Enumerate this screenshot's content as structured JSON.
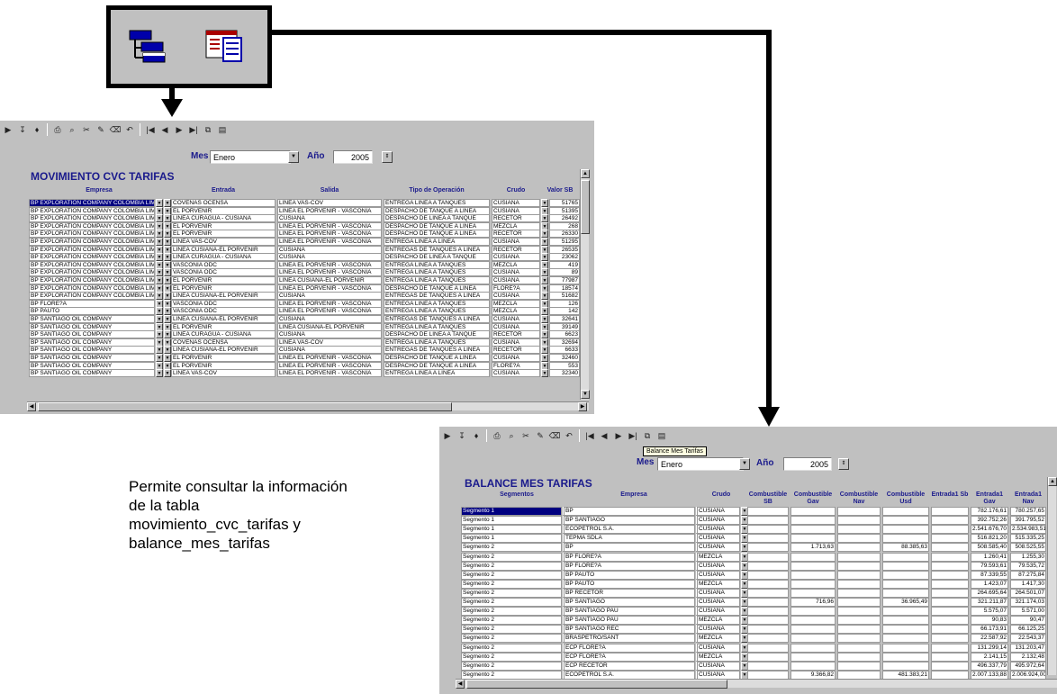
{
  "caption": "Permite consultar la información de la tabla movimiento_cvc_tarifas y balance_mes_tarifas",
  "big_toolbar": {
    "icons": [
      "forms-tree-icon",
      "report-sheet-icon"
    ]
  },
  "toolbar_glyphs": [
    "▶",
    "↧",
    "♦",
    "⎙",
    "⌕",
    "✂",
    "✎",
    "⌫",
    "↶",
    "|◀",
    "◀",
    "▶",
    "▶|",
    "⧉",
    "▤"
  ],
  "mov": {
    "mes_label": "Mes",
    "mes_value": "Enero",
    "anio_label": "Año",
    "anio_value": "2005",
    "title": "MOVIMIENTO CVC TARIFAS",
    "columns": [
      "Empresa",
      "Entrada",
      "Salida",
      "Tipo de Operación",
      "Crudo",
      "Valor SB"
    ],
    "rows": [
      [
        "BP EXPLORATION COMPANY COLOMBIA LIMI",
        "COVENAS OCENSA",
        "LINEA VAS-COV",
        "ENTREGA LINEA A TANQUES",
        "CUSIANA",
        "51765"
      ],
      [
        "BP EXPLORATION COMPANY COLOMBIA LIMI",
        "EL PORVENIR",
        "LINEA  EL PORVENIR - VASCONIA",
        "DESPACHO DE TANQUE A LINEA",
        "CUSIANA",
        "51395"
      ],
      [
        "BP EXPLORATION COMPANY COLOMBIA LIMI",
        "LINEA CURAGUA - CUSIANA",
        "CUSIANA",
        "DESPACHO DE LINEA A TANQUE",
        "RECETOR",
        "26492"
      ],
      [
        "BP EXPLORATION COMPANY COLOMBIA LIMI",
        "EL PORVENIR",
        "LINEA  EL PORVENIR - VASCONIA",
        "DESPACHO DE TANQUE A LINEA",
        "MEZCLA",
        "268"
      ],
      [
        "BP EXPLORATION COMPANY COLOMBIA LIMI",
        "EL PORVENIR",
        "LINEA  EL PORVENIR - VASCONIA",
        "DESPACHO DE TANQUE A LINEA",
        "RECETOR",
        "26330"
      ],
      [
        "BP EXPLORATION COMPANY COLOMBIA LIMI",
        "LINEA VAS-COV",
        "LINEA  EL PORVENIR - VASCONIA",
        "ENTREGA LINEA A LINEA",
        "CUSIANA",
        "51295"
      ],
      [
        "BP EXPLORATION COMPANY COLOMBIA LIMI",
        "LINEA  CUSIANA-EL PORVENIR",
        "CUSIANA",
        "ENTREGAS DE TANQUES A LINEA",
        "RECETOR",
        "26535"
      ],
      [
        "BP EXPLORATION COMPANY COLOMBIA LIMI",
        "LINEA CURAGUA - CUSIANA",
        "CUSIANA",
        "DESPACHO DE LINEA A TANQUE",
        "CUSIANA",
        "23062"
      ],
      [
        "BP EXPLORATION COMPANY COLOMBIA LIMI",
        "VASCONIA ODC",
        "LINEA  EL PORVENIR - VASCONIA",
        "ENTREGA LINEA A TANQUES",
        "MEZCLA",
        "419"
      ],
      [
        "BP EXPLORATION COMPANY COLOMBIA LIMI",
        "VASCONIA ODC",
        "LINEA  EL PORVENIR - VASCONIA",
        "ENTREGA LINEA A TANQUES",
        "CUSIANA",
        "89"
      ],
      [
        "BP EXPLORATION COMPANY COLOMBIA LIMI",
        "EL PORVENIR",
        "LINEA  CUSIANA-EL PORVENIR",
        "ENTREGA LINEA A TANQUES",
        "CUSIANA",
        "77987"
      ],
      [
        "BP EXPLORATION COMPANY COLOMBIA LIMI",
        "EL PORVENIR",
        "LINEA  EL PORVENIR - VASCONIA",
        "DESPACHO DE TANQUE A LINEA",
        "FLORE?A",
        "18574"
      ],
      [
        "BP EXPLORATION COMPANY COLOMBIA LIMI",
        "LINEA  CUSIANA-EL PORVENIR",
        "CUSIANA",
        "ENTREGAS DE TANQUES A LINEA",
        "CUSIANA",
        "51682"
      ],
      [
        "BP FLORE?A",
        "VASCONIA ODC",
        "LINEA  EL PORVENIR - VASCONIA",
        "ENTREGA LINEA A TANQUES",
        "MEZCLA",
        "126"
      ],
      [
        "BP PAUTO",
        "VASCONIA ODC",
        "LINEA  EL PORVENIR - VASCONIA",
        "ENTREGA LINEA A TANQUES",
        "MEZCLA",
        "142"
      ],
      [
        "BP SANTIAGO OIL COMPANY",
        "LINEA  CUSIANA-EL PORVENIR",
        "CUSIANA",
        "ENTREGAS DE TANQUES A LINEA",
        "CUSIANA",
        "32641"
      ],
      [
        "BP SANTIAGO OIL COMPANY",
        "EL PORVENIR",
        "LINEA  CUSIANA-EL PORVENIR",
        "ENTREGA LINEA A TANQUES",
        "CUSIANA",
        "39149"
      ],
      [
        "BP SANTIAGO OIL COMPANY",
        "LINEA CURAGUA - CUSIANA",
        "CUSIANA",
        "DESPACHO DE LINEA A TANQUE",
        "RECETOR",
        "6623"
      ],
      [
        "BP SANTIAGO OIL COMPANY",
        "COVENAS OCENSA",
        "LINEA VAS-COV",
        "ENTREGA LINEA A TANQUES",
        "CUSIANA",
        "32694"
      ],
      [
        "BP SANTIAGO OIL COMPANY",
        "LINEA  CUSIANA-EL PORVENIR",
        "CUSIANA",
        "ENTREGAS DE TANQUES A LINEA",
        "RECETOR",
        "6633"
      ],
      [
        "BP SANTIAGO OIL COMPANY",
        "EL PORVENIR",
        "LINEA  EL PORVENIR - VASCONIA",
        "DESPACHO DE TANQUE A LINEA",
        "CUSIANA",
        "32460"
      ],
      [
        "BP SANTIAGO OIL COMPANY",
        "EL PORVENIR",
        "LINEA  EL PORVENIR - VASCONIA",
        "DESPACHO DE TANQUE A LINEA",
        "FLORE?A",
        "553"
      ],
      [
        "BP SANTIAGO OIL COMPANY",
        "LINEA VAS-COV",
        "LINEA  EL PORVENIR - VASCONIA",
        "ENTREGA LINEA A LINEA",
        "CUSIANA",
        "32340"
      ]
    ]
  },
  "bal": {
    "tooltip": "Balance Mes Tarifas",
    "mes_label": "Mes",
    "mes_value": "Enero",
    "anio_label": "Año",
    "anio_value": "2005",
    "title": "BALANCE MES TARIFAS",
    "columns": [
      "Segmentos",
      "Empresa",
      "Crudo",
      "Combustible SB",
      "Combustible Gav",
      "Combustible Nav",
      "Combustible Usd",
      "Entrada1 Sb",
      "Entrada1 Gav",
      "Entrada1 Nav"
    ],
    "rows": [
      [
        "Segmento 1",
        "BP",
        "CUSIANA",
        "",
        "",
        "",
        "",
        "",
        "782.176,61",
        "780.257,65"
      ],
      [
        "Segmento 1",
        "BP SANTIAGO",
        "CUSIANA",
        "",
        "",
        "",
        "",
        "",
        "392.752,26",
        "391.795,52"
      ],
      [
        "Segmento 1",
        "ECOPETROL S.A.",
        "CUSIANA",
        "",
        "",
        "",
        "",
        "",
        "2.541.676,70",
        "2.534.983,51"
      ],
      [
        "Segmento 1",
        "TEPMA SDLA",
        "CUSIANA",
        "",
        "",
        "",
        "",
        "",
        "516.821,20",
        "515.335,25"
      ],
      [
        "Segmento 2",
        "BP",
        "CUSIANA",
        "",
        "1.713,63",
        "",
        "88.385,63",
        "",
        "508.585,40",
        "508.525,55"
      ],
      [
        "Segmento 2",
        "BP FLORE?A",
        "MEZCLA",
        "",
        "",
        "",
        "",
        "",
        "1.260,41",
        "1.255,30"
      ],
      [
        "Segmento 2",
        "BP FLORE?A",
        "CUSIANA",
        "",
        "",
        "",
        "",
        "",
        "79.593,61",
        "79.535,72"
      ],
      [
        "Segmento 2",
        "BP PAUTO",
        "CUSIANA",
        "",
        "",
        "",
        "",
        "",
        "87.339,55",
        "87.275,84"
      ],
      [
        "Segmento 2",
        "BP PAUTO",
        "MEZCLA",
        "",
        "",
        "",
        "",
        "",
        "1.423,07",
        "1.417,30"
      ],
      [
        "Segmento 2",
        "BP RECETOR",
        "CUSIANA",
        "",
        "",
        "",
        "",
        "",
        "264.695,64",
        "264.501,07"
      ],
      [
        "Segmento 2",
        "BP SANTIAGO",
        "CUSIANA",
        "",
        "716,96",
        "",
        "36.965,49",
        "",
        "321.211,87",
        "321.174,03"
      ],
      [
        "Segmento 2",
        "BP SANTIAGO PAU",
        "CUSIANA",
        "",
        "",
        "",
        "",
        "",
        "5.575,07",
        "5.571,00"
      ],
      [
        "Segmento 2",
        "BP SANTIAGO PAU",
        "MEZCLA",
        "",
        "",
        "",
        "",
        "",
        "90,83",
        "90,47"
      ],
      [
        "Segmento 2",
        "BP SANTIAGO REC",
        "CUSIANA",
        "",
        "",
        "",
        "",
        "",
        "66.173,91",
        "66.125,25"
      ],
      [
        "Segmento 2",
        "BRASPETRO/SANT",
        "MEZCLA",
        "",
        "",
        "",
        "",
        "",
        "22.587,92",
        "22.543,37"
      ],
      [
        "Segmento 2",
        "ECP FLORE?A",
        "CUSIANA",
        "",
        "",
        "",
        "",
        "",
        "131.299,14",
        "131.203,47"
      ],
      [
        "Segmento 2",
        "ECP FLORE?A",
        "MEZCLA",
        "",
        "",
        "",
        "",
        "",
        "2.141,15",
        "2.132,48"
      ],
      [
        "Segmento 2",
        "ECP RECETOR",
        "CUSIANA",
        "",
        "",
        "",
        "",
        "",
        "496.337,79",
        "495.972,64"
      ],
      [
        "Segmento 2",
        "ECOPETROL S.A.",
        "CUSIANA",
        "",
        "9.366,82",
        "",
        "481.383,21",
        "",
        "2.007.133,88",
        "2.006.924,00"
      ]
    ]
  }
}
